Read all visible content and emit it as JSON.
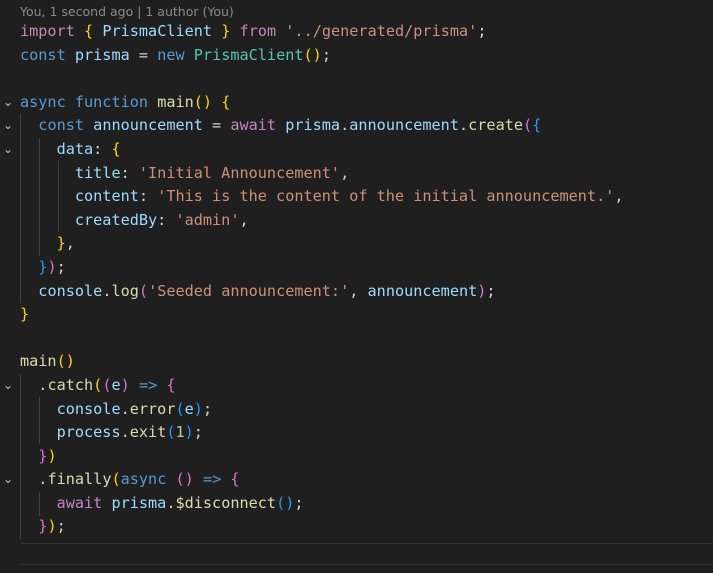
{
  "editor": {
    "blame_text": "You, 1 second ago | 1 author (You)"
  },
  "code": {
    "l1": {
      "t1": "import",
      "t2": " ",
      "t3": "{",
      "t4": " ",
      "t5": "PrismaClient",
      "t6": " ",
      "t7": "}",
      "t8": " ",
      "t9": "from",
      "t10": " ",
      "t11": "'../generated/prisma'",
      "t12": ";"
    },
    "l2": {
      "t1": "const",
      "t2": " ",
      "t3": "prisma",
      "t4": " = ",
      "t5": "new",
      "t6": " ",
      "t7": "PrismaClient",
      "t8": "(",
      "t9": ")",
      "t10": ";"
    },
    "l4": {
      "t1": "async",
      "t2": " ",
      "t3": "function",
      "t4": " ",
      "t5": "main",
      "t6": "(",
      "t7": ")",
      "t8": " ",
      "t9": "{"
    },
    "l5": {
      "t1": "  ",
      "t2": "const",
      "t3": " ",
      "t4": "announcement",
      "t5": " = ",
      "t6": "await",
      "t7": " ",
      "t8": "prisma",
      "t9": ".",
      "t10": "announcement",
      "t11": ".",
      "t12": "create",
      "t13": "(",
      "t14": "{"
    },
    "l6": {
      "t1": "    ",
      "t2": "data",
      "t3": ": ",
      "t4": "{"
    },
    "l7": {
      "t1": "      ",
      "t2": "title",
      "t3": ": ",
      "t4": "'Initial Announcement'",
      "t5": ","
    },
    "l8": {
      "t1": "      ",
      "t2": "content",
      "t3": ": ",
      "t4": "'This is the content of the initial announcement.'",
      "t5": ","
    },
    "l9": {
      "t1": "      ",
      "t2": "createdBy",
      "t3": ": ",
      "t4": "'admin'",
      "t5": ","
    },
    "l10": {
      "t1": "    ",
      "t2": "}",
      "t3": ","
    },
    "l11": {
      "t1": "  ",
      "t2": "}",
      "t3": ")",
      "t4": ";"
    },
    "l12": {
      "t1": "  ",
      "t2": "console",
      "t3": ".",
      "t4": "log",
      "t5": "(",
      "t6": "'Seeded announcement:'",
      "t7": ", ",
      "t8": "announcement",
      "t9": ")",
      "t10": ";"
    },
    "l13": {
      "t1": "}"
    },
    "l15": {
      "t1": "main",
      "t2": "(",
      "t3": ")"
    },
    "l16": {
      "t1": "  ",
      "t2": ".",
      "t3": "catch",
      "t4": "(",
      "t5": "(",
      "t6": "e",
      "t7": ")",
      "t8": " ",
      "t9": "=>",
      "t10": " ",
      "t11": "{"
    },
    "l17": {
      "t1": "    ",
      "t2": "console",
      "t3": ".",
      "t4": "error",
      "t5": "(",
      "t6": "e",
      "t7": ")",
      "t8": ";"
    },
    "l18": {
      "t1": "    ",
      "t2": "process",
      "t3": ".",
      "t4": "exit",
      "t5": "(",
      "t6": "1",
      "t7": ")",
      "t8": ";"
    },
    "l19": {
      "t1": "  ",
      "t2": "}",
      "t3": ")"
    },
    "l20": {
      "t1": "  ",
      "t2": ".",
      "t3": "finally",
      "t4": "(",
      "t5": "async",
      "t6": " ",
      "t7": "(",
      "t8": ")",
      "t9": " ",
      "t10": "=>",
      "t11": " ",
      "t12": "{"
    },
    "l21": {
      "t1": "    ",
      "t2": "await",
      "t3": " ",
      "t4": "prisma",
      "t5": ".",
      "t6": "$disconnect",
      "t7": "(",
      "t8": ")",
      "t9": ";"
    },
    "l22": {
      "t1": "  ",
      "t2": "}",
      "t3": ")",
      "t4": ";"
    }
  },
  "gutter": {
    "fold_icon": "⌄"
  },
  "colors": {
    "background": "#1f1f1f",
    "keyword": "#569cd6",
    "control": "#c586c0",
    "variable": "#9cdcfe",
    "function": "#dcdcaa",
    "class": "#4ec9b0",
    "string": "#ce9178",
    "number": "#b5cea8"
  }
}
